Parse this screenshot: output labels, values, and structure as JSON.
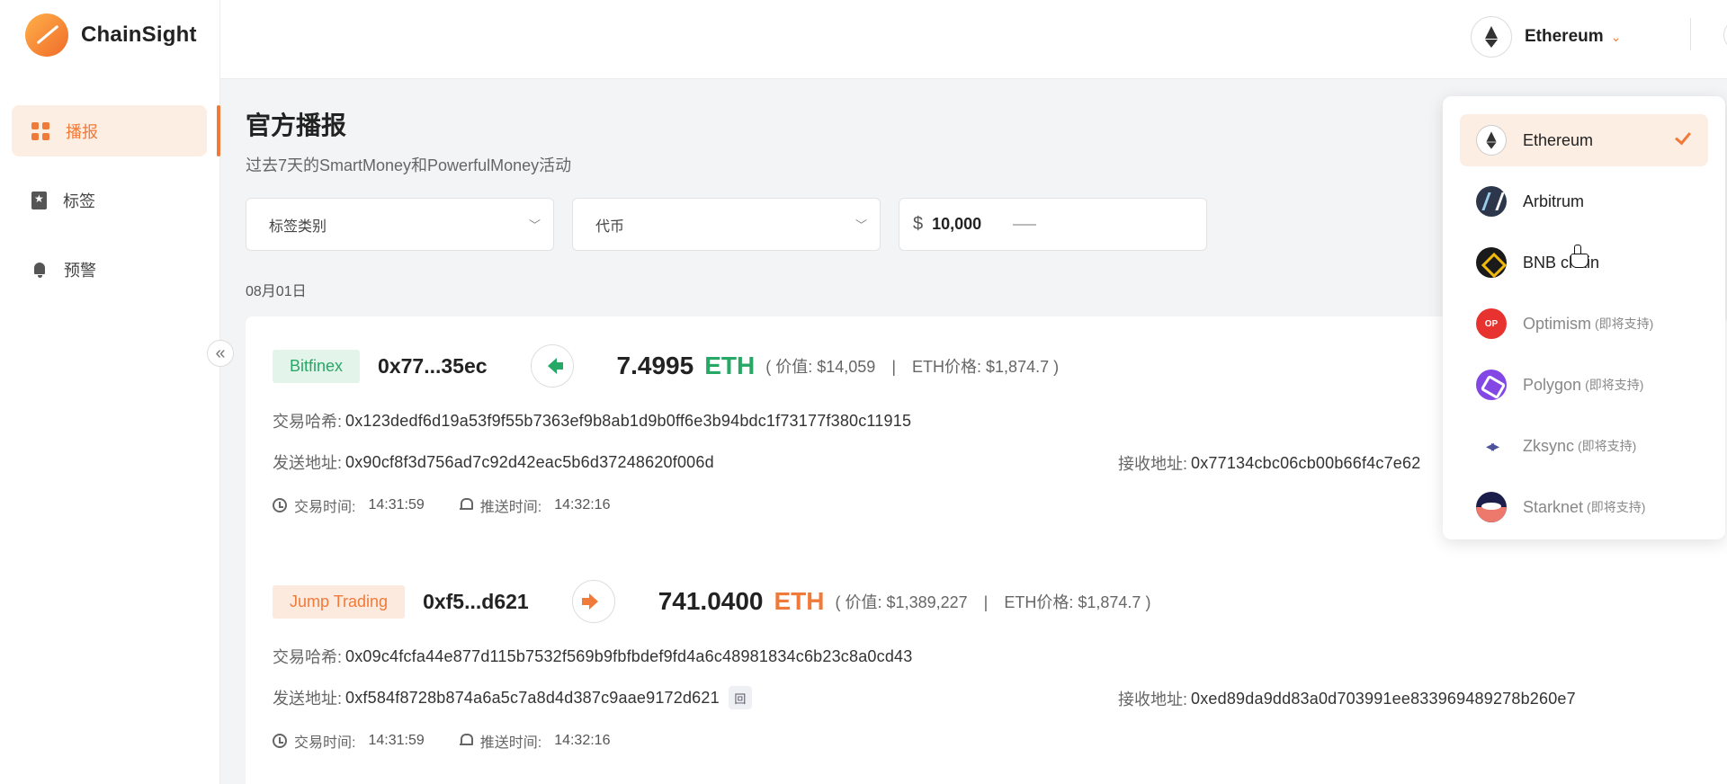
{
  "brand": {
    "name": "ChainSight"
  },
  "sidebar": {
    "items": [
      {
        "label": "播报",
        "icon": "grid-icon",
        "active": true
      },
      {
        "label": "标签",
        "icon": "bookmark-icon",
        "active": false
      },
      {
        "label": "预警",
        "icon": "bell-icon",
        "active": false
      }
    ],
    "collapse_glyph": "«"
  },
  "header": {
    "chain": "Ethereum",
    "chevron": "⌄"
  },
  "page": {
    "title": "官方播报",
    "subtitle": "过去7天的SmartMoney和PowerfulMoney活动",
    "filters": {
      "tag_type": "标签类别",
      "token": "代币",
      "currency_symbol": "$",
      "min_amount": "10,000"
    },
    "date": "08月01日"
  },
  "labels": {
    "hash": "交易哈希:",
    "from": "发送地址:",
    "to": "接收地址:",
    "tx_time": "交易时间:",
    "push_time": "推送时间:",
    "value": "价值:",
    "eth_price": "ETH价格:",
    "open_paren": "(",
    "close_paren": ")",
    "sep": "|"
  },
  "transactions": [
    {
      "entity": "Bitfinex",
      "entity_color": "#27a866",
      "address_short": "0x77...35ec",
      "direction": "in",
      "amount": "7.4995",
      "token": "ETH",
      "value": "$14,059",
      "eth_price": "$1,874.7",
      "hash": "0x123dedf6d19a53f9f55b7363ef9b8ab1d9b0ff6e3b94bdc1f73177f380c11915",
      "from": "0x90cf8f3d756ad7c92d42eac5b6d37248620f006d",
      "to": "0x77134cbc06cb00b66f4c7e62",
      "tx_time": "14:31:59",
      "push_time": "14:32:16"
    },
    {
      "entity": "Jump Trading",
      "entity_color": "#f07a3a",
      "address_short": "0xf5...d621",
      "direction": "out",
      "amount": "741.0400",
      "token": "ETH",
      "value": "$1,389,227",
      "eth_price": "$1,874.7",
      "hash": "0x09c4fcfa44e877d115b7532f569b9fbfbdef9fd4a6c48981834c6b23c8a0cd43",
      "from": "0xf584f8728b874a6a5c7a8d4d387c9aae9172d621",
      "copy_glyph": "回",
      "to": "0xed89da9dd83a0d703991ee833969489278b260e7",
      "tx_time": "14:31:59",
      "push_time": "14:32:16"
    }
  ],
  "chain_dropdown": {
    "items": [
      {
        "label": "Ethereum",
        "soon": "",
        "selected": true
      },
      {
        "label": "Arbitrum",
        "soon": ""
      },
      {
        "label": "BNB chain",
        "soon": ""
      },
      {
        "label": "Optimism",
        "soon": "(即将支持)",
        "icon_text": "OP"
      },
      {
        "label": "Polygon",
        "soon": "(即将支持)"
      },
      {
        "label": "Zksync",
        "soon": "(即将支持)"
      },
      {
        "label": "Starknet",
        "soon": "(即将支持)"
      }
    ]
  },
  "colors": {
    "accent": "#f07a3a",
    "inflow": "#27a866"
  }
}
